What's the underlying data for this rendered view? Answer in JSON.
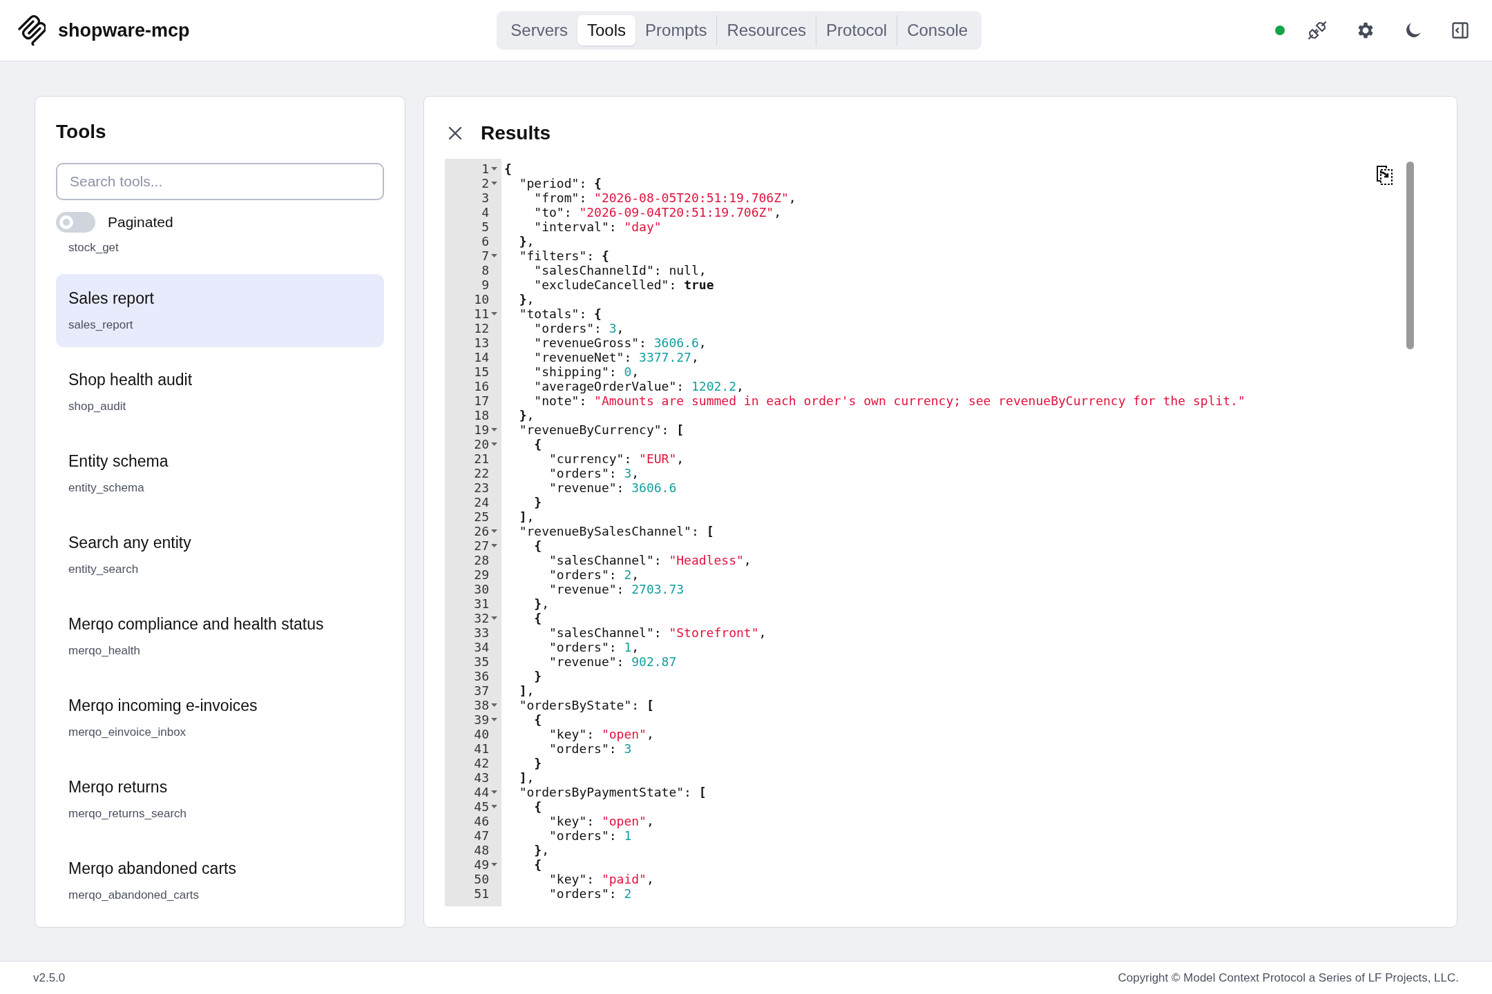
{
  "app": {
    "name": "shopware-mcp"
  },
  "nav_tabs": [
    {
      "label": "Servers",
      "selected": false
    },
    {
      "label": "Tools",
      "selected": true
    },
    {
      "label": "Prompts",
      "selected": false
    },
    {
      "label": "Resources",
      "selected": false
    },
    {
      "label": "Protocol",
      "selected": false
    },
    {
      "label": "Console",
      "selected": false
    }
  ],
  "connection": {
    "color": "#16a34a"
  },
  "tools_panel": {
    "title": "Tools",
    "search": {
      "placeholder": "Search tools..."
    },
    "paginated": {
      "label": "Paginated",
      "on": false
    },
    "items": [
      {
        "name": "stock_get",
        "selected": false
      },
      {
        "title": "Sales report",
        "name": "sales_report",
        "selected": true
      },
      {
        "title": "Shop health audit",
        "name": "shop_audit",
        "selected": false
      },
      {
        "title": "Entity schema",
        "name": "entity_schema",
        "selected": false
      },
      {
        "title": "Search any entity",
        "name": "entity_search",
        "selected": false
      },
      {
        "title": "Merqo compliance and health status",
        "name": "merqo_health",
        "selected": false
      },
      {
        "title": "Merqo incoming e-invoices",
        "name": "merqo_einvoice_inbox",
        "selected": false
      },
      {
        "title": "Merqo returns",
        "name": "merqo_returns_search",
        "selected": false
      },
      {
        "title": "Merqo abandoned carts",
        "name": "merqo_abandoned_carts",
        "selected": false
      }
    ]
  },
  "results_panel": {
    "title": "Results",
    "code_lines": [
      {
        "number": "1",
        "text": "{",
        "foldable": true
      },
      {
        "number": "2",
        "text": "  \"period\": {",
        "foldable": true
      },
      {
        "number": "3",
        "text": "    \"from\": \"2026-08-05T20:51:19.706Z\",",
        "foldable": false
      },
      {
        "number": "4",
        "text": "    \"to\": \"2026-09-04T20:51:19.706Z\",",
        "foldable": false
      },
      {
        "number": "5",
        "text": "    \"interval\": \"day\"",
        "foldable": false
      },
      {
        "number": "6",
        "text": "  },",
        "foldable": false
      },
      {
        "number": "7",
        "text": "  \"filters\": {",
        "foldable": true
      },
      {
        "number": "8",
        "text": "    \"salesChannelId\": null,",
        "foldable": false
      },
      {
        "number": "9",
        "text": "    \"excludeCancelled\": true",
        "foldable": false
      },
      {
        "number": "10",
        "text": "  },",
        "foldable": false
      },
      {
        "number": "11",
        "text": "  \"totals\": {",
        "foldable": true
      },
      {
        "number": "12",
        "text": "    \"orders\": 3,",
        "foldable": false
      },
      {
        "number": "13",
        "text": "    \"revenueGross\": 3606.6,",
        "foldable": false
      },
      {
        "number": "14",
        "text": "    \"revenueNet\": 3377.27,",
        "foldable": false
      },
      {
        "number": "15",
        "text": "    \"shipping\": 0,",
        "foldable": false
      },
      {
        "number": "16",
        "text": "    \"averageOrderValue\": 1202.2,",
        "foldable": false
      },
      {
        "number": "17",
        "text": "    \"note\": \"Amounts are summed in each order's own currency; see revenueByCurrency for the split.\"",
        "foldable": false
      },
      {
        "number": "18",
        "text": "  },",
        "foldable": false
      },
      {
        "number": "19",
        "text": "  \"revenueByCurrency\": [",
        "foldable": true
      },
      {
        "number": "20",
        "text": "    {",
        "foldable": true
      },
      {
        "number": "21",
        "text": "      \"currency\": \"EUR\",",
        "foldable": false
      },
      {
        "number": "22",
        "text": "      \"orders\": 3,",
        "foldable": false
      },
      {
        "number": "23",
        "text": "      \"revenue\": 3606.6",
        "foldable": false
      },
      {
        "number": "24",
        "text": "    }",
        "foldable": false
      },
      {
        "number": "25",
        "text": "  ],",
        "foldable": false
      },
      {
        "number": "26",
        "text": "  \"revenueBySalesChannel\": [",
        "foldable": true
      },
      {
        "number": "27",
        "text": "    {",
        "foldable": true
      },
      {
        "number": "28",
        "text": "      \"salesChannel\": \"Headless\",",
        "foldable": false
      },
      {
        "number": "29",
        "text": "      \"orders\": 2,",
        "foldable": false
      },
      {
        "number": "30",
        "text": "      \"revenue\": 2703.73",
        "foldable": false
      },
      {
        "number": "31",
        "text": "    },",
        "foldable": false
      },
      {
        "number": "32",
        "text": "    {",
        "foldable": true
      },
      {
        "number": "33",
        "text": "      \"salesChannel\": \"Storefront\",",
        "foldable": false
      },
      {
        "number": "34",
        "text": "      \"orders\": 1,",
        "foldable": false
      },
      {
        "number": "35",
        "text": "      \"revenue\": 902.87",
        "foldable": false
      },
      {
        "number": "36",
        "text": "    }",
        "foldable": false
      },
      {
        "number": "37",
        "text": "  ],",
        "foldable": false
      },
      {
        "number": "38",
        "text": "  \"ordersByState\": [",
        "foldable": true
      },
      {
        "number": "39",
        "text": "    {",
        "foldable": true
      },
      {
        "number": "40",
        "text": "      \"key\": \"open\",",
        "foldable": false
      },
      {
        "number": "41",
        "text": "      \"orders\": 3",
        "foldable": false
      },
      {
        "number": "42",
        "text": "    }",
        "foldable": false
      },
      {
        "number": "43",
        "text": "  ],",
        "foldable": false
      },
      {
        "number": "44",
        "text": "  \"ordersByPaymentState\": [",
        "foldable": true
      },
      {
        "number": "45",
        "text": "    {",
        "foldable": true
      },
      {
        "number": "46",
        "text": "      \"key\": \"open\",",
        "foldable": false
      },
      {
        "number": "47",
        "text": "      \"orders\": 1",
        "foldable": false
      },
      {
        "number": "48",
        "text": "    },",
        "foldable": false
      },
      {
        "number": "49",
        "text": "    {",
        "foldable": true
      },
      {
        "number": "50",
        "text": "      \"key\": \"paid\",",
        "foldable": false
      },
      {
        "number": "51",
        "text": "      \"orders\": 2",
        "foldable": false
      }
    ]
  },
  "footer": {
    "version": "v2.5.0",
    "copyright": "Copyright © Model Context Protocol a Series of LF Projects, LLC."
  }
}
